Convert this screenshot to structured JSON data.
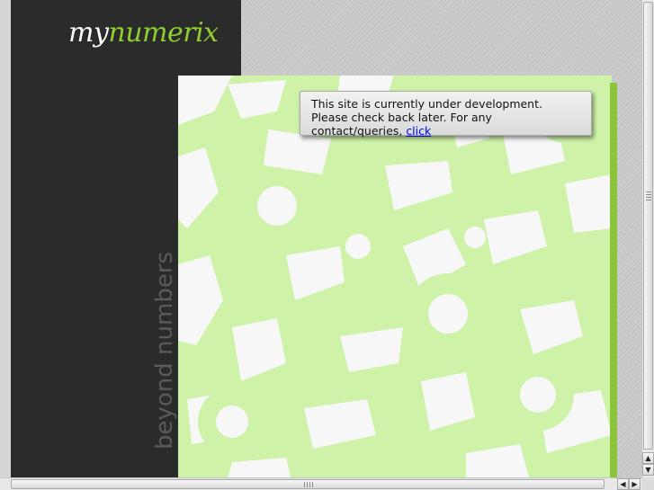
{
  "logo": {
    "part1": "my",
    "part2": "numerix"
  },
  "tagline": "beyond numbers",
  "notice": {
    "text": "This site is currently under development. Please check back later. For any contact/queries, ",
    "link": "click"
  },
  "colors": {
    "sidebar": "#2b2b2b",
    "logo_accent": "#8fcf2f",
    "art_green": "#cdf2a8",
    "art_white": "#f7f7f7",
    "link": "#0000ee"
  },
  "icons": {
    "scroll_up": "▲",
    "scroll_down": "▼",
    "scroll_left": "◀",
    "scroll_right": "▶"
  }
}
